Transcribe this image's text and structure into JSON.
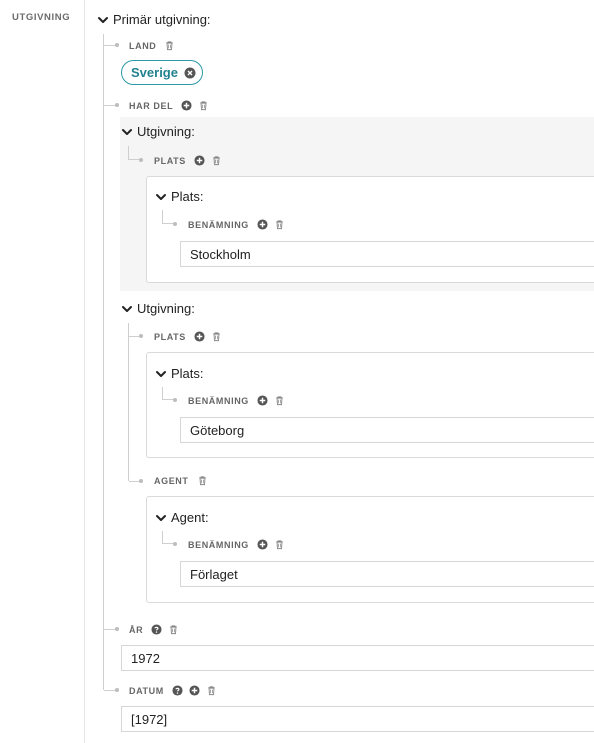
{
  "sidebar": {
    "label": "UTGIVNING"
  },
  "primary": {
    "header": "Primär utgivning:",
    "land": {
      "label": "LAND",
      "chip": "Sverige"
    },
    "har_del": {
      "label": "HAR DEL",
      "items": [
        {
          "header": "Utgivning:",
          "plats_label": "PLATS",
          "plats": {
            "header": "Plats:",
            "benamning_label": "BENÄMNING",
            "value": "Stockholm"
          }
        },
        {
          "header": "Utgivning:",
          "plats_label": "PLATS",
          "plats": {
            "header": "Plats:",
            "benamning_label": "BENÄMNING",
            "value": "Göteborg"
          },
          "agent_label": "AGENT",
          "agent": {
            "header": "Agent:",
            "benamning_label": "BENÄMNING",
            "value": "Förlaget"
          }
        }
      ]
    },
    "ar": {
      "label": "ÅR",
      "value": "1972"
    },
    "datum": {
      "label": "DATUM",
      "value": "[1972]"
    }
  },
  "icons": {
    "chevron": "chevron-down-icon",
    "add": "plus-circle-icon",
    "delete": "trash-icon",
    "help": "question-circle-icon",
    "remove": "close-circle-icon"
  },
  "colors": {
    "accent": "#2a9aa7",
    "icon": "#555555",
    "shade": "#f5f5f5"
  }
}
